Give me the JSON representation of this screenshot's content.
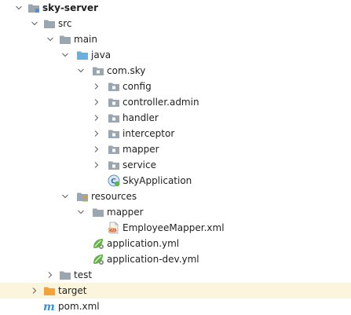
{
  "tree": {
    "root": {
      "label": "sky-server"
    },
    "src": {
      "label": "src"
    },
    "main": {
      "label": "main"
    },
    "java": {
      "label": "java"
    },
    "package": {
      "label": "com.sky"
    },
    "config": {
      "label": "config"
    },
    "controller_admin": {
      "label": "controller.admin"
    },
    "handler": {
      "label": "handler"
    },
    "interceptor": {
      "label": "interceptor"
    },
    "mapper_pkg": {
      "label": "mapper"
    },
    "service": {
      "label": "service"
    },
    "sky_application": {
      "label": "SkyApplication"
    },
    "resources": {
      "label": "resources"
    },
    "mapper_res": {
      "label": "mapper"
    },
    "employee_mapper": {
      "label": "EmployeeMapper.xml"
    },
    "application_yml": {
      "label": "application.yml"
    },
    "application_dev_yml": {
      "label": "application-dev.yml"
    },
    "test": {
      "label": "test"
    },
    "target": {
      "label": "target"
    },
    "pom": {
      "label": "pom.xml"
    }
  },
  "colors": {
    "selection_row": "#fcf5dd",
    "folder_gray": "#9aa7b0",
    "folder_blue": "#6ab0de",
    "folder_orange": "#f4a23a",
    "spring_green": "#62b543",
    "maven_blue": "#3d8fd1"
  }
}
